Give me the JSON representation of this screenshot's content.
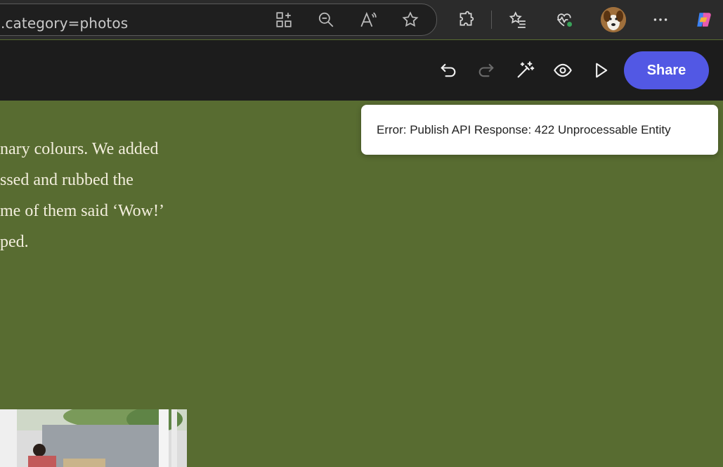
{
  "browser": {
    "url_text": ".category=photos",
    "icons": [
      "app-grid-icon",
      "zoom-out-icon",
      "read-aloud-icon",
      "favorite-star-icon",
      "extensions-icon",
      "favorites-list-icon",
      "browser-health-icon",
      "profile-avatar",
      "more-options-icon",
      "copilot-icon"
    ]
  },
  "toolbar": {
    "icons": [
      "undo-icon",
      "redo-icon",
      "magic-wand-icon",
      "preview-eye-icon",
      "play-icon"
    ],
    "share_label": "Share",
    "share_color": "#5258e4"
  },
  "content": {
    "background_color": "#586c31",
    "lines": [
      "nary colours. We added",
      "ssed and rubbed the",
      "me of them said ‘Wow!’",
      "ped."
    ]
  },
  "toast": {
    "message": "Error: Publish API Response: 422 Unprocessable Entity"
  }
}
